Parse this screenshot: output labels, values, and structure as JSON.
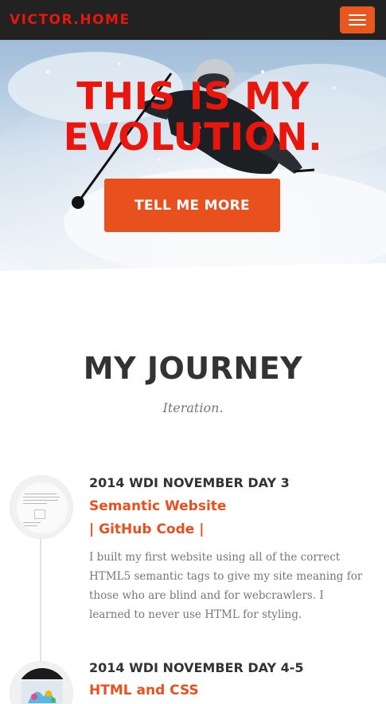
{
  "navbar": {
    "brand": "VICTOR.HOME",
    "menu_icon": "hamburger-menu-icon",
    "accent_color": "#e8501e",
    "brand_color": "#e8160c"
  },
  "hero": {
    "title_line1": "THIS IS MY",
    "title_line2": "EVOLUTION.",
    "button_label": "TELL ME MORE",
    "image": "skier-in-powder-snow"
  },
  "journey": {
    "heading": "MY JOURNEY",
    "subheading": "Iteration.",
    "items": [
      {
        "date": "2014 WDI NOVEMBER DAY 3",
        "title": "Semantic Website",
        "link": "| GitHub Code |",
        "body": "I built my first website using all of the correct HTML5 semantic tags to give my site meaning for those who are blind and for webcrawlers. I learned to never use HTML for styling.",
        "thumbnail": "document-screenshot"
      },
      {
        "date": "2014 WDI NOVEMBER DAY 4-5",
        "title": "HTML and CSS",
        "thumbnail": "colorful-website-screenshot"
      }
    ]
  }
}
